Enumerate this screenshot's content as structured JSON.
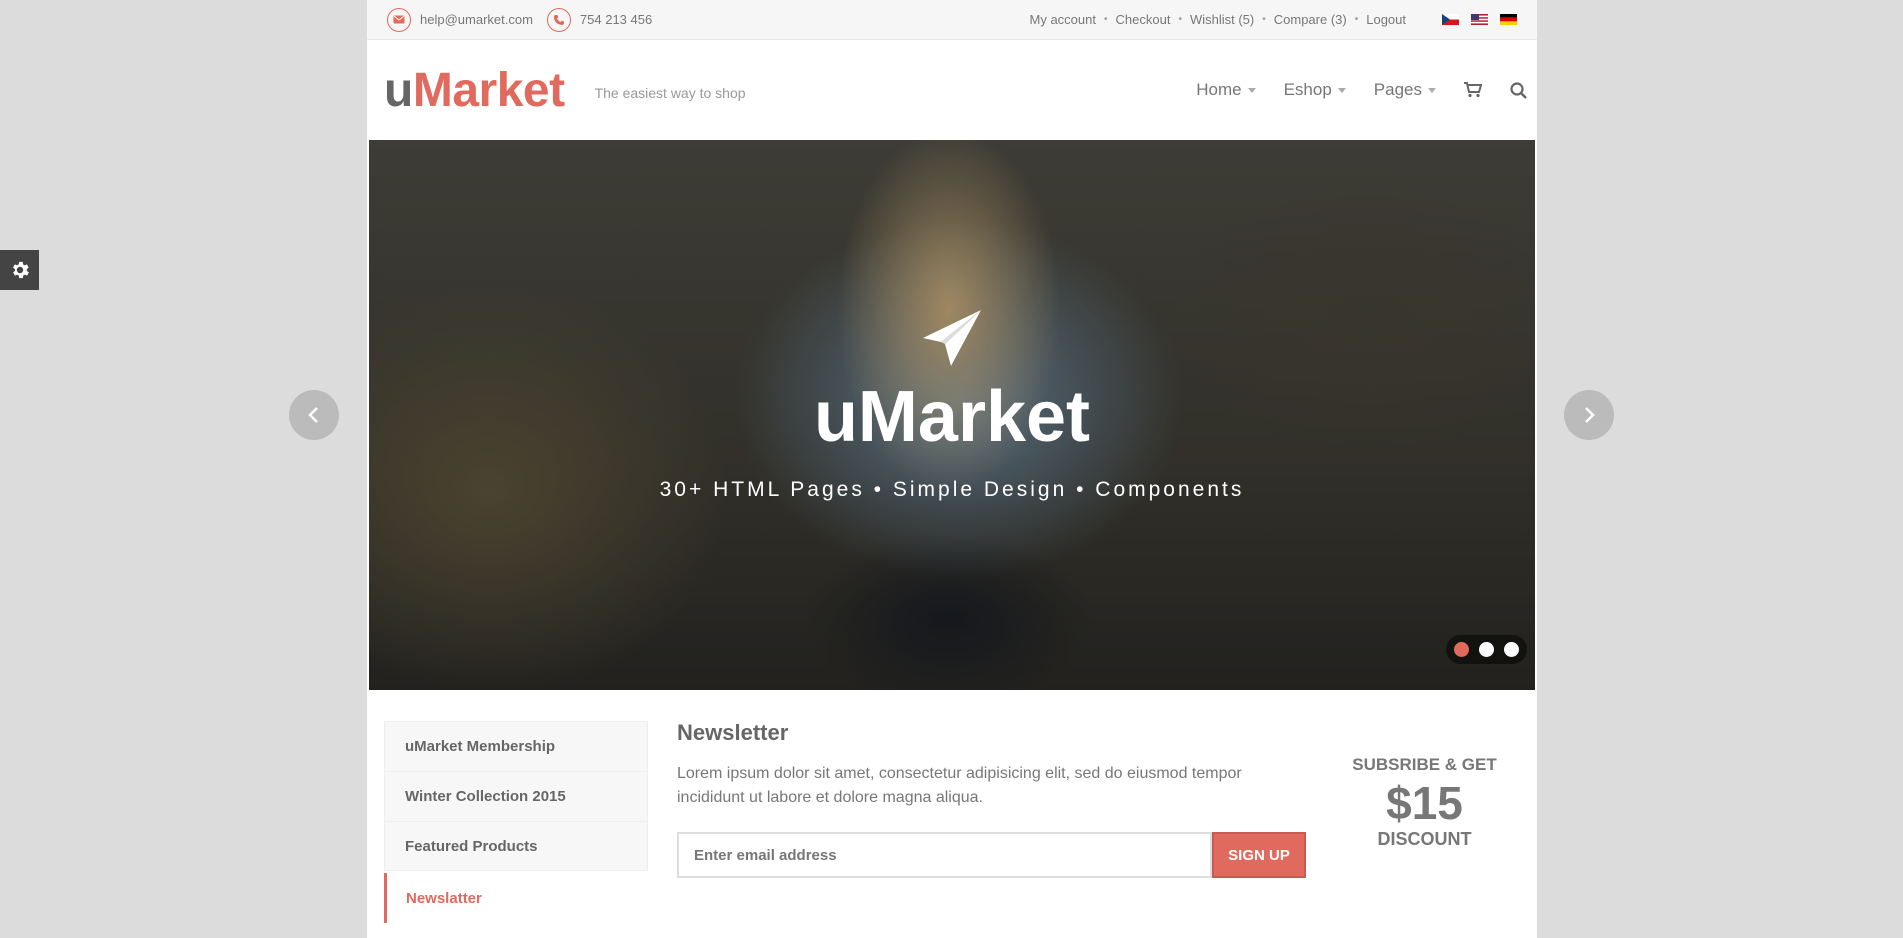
{
  "topbar": {
    "email": "help@umarket.com",
    "phone": "754 213 456",
    "links": [
      "My account",
      "Checkout",
      "Wishlist (5)",
      "Compare (3)",
      "Logout"
    ],
    "separator": "•",
    "icons": [
      "envelope-icon",
      "phone-icon",
      "flag-cz-icon",
      "flag-us-icon",
      "flag-de-icon"
    ]
  },
  "header": {
    "logo_u": "u",
    "logo_rest": "Market",
    "tagline": "The easiest way to shop",
    "nav": [
      {
        "label": "Home"
      },
      {
        "label": "Eshop"
      },
      {
        "label": "Pages"
      }
    ],
    "icons": [
      "cart-icon",
      "search-icon"
    ]
  },
  "slider": {
    "title": "uMarket",
    "subtitle": "30+ HTML Pages • Simple Design • Components",
    "active_dot": 1,
    "dot_count": 3,
    "icons": [
      "paper-plane-icon",
      "chevron-left-icon",
      "chevron-right-icon"
    ]
  },
  "sidenav": {
    "items": [
      "uMarket Membership",
      "Winter Collection 2015",
      "Featured Products",
      "Newslatter"
    ],
    "active": "Newslatter"
  },
  "newsletter": {
    "title": "Newsletter",
    "text": "Lorem ipsum dolor sit amet, consectetur adipisicing elit, sed do eiusmod tempor incididunt ut labore et dolore magna aliqua.",
    "placeholder": "Enter email address",
    "button": "SIGN UP"
  },
  "promo": {
    "line1": "SUBSRIBE & GET",
    "price": "$15",
    "line3": "DISCOUNT"
  },
  "colors": {
    "accent": "#e06a5e",
    "background": "#dcdcdc"
  }
}
